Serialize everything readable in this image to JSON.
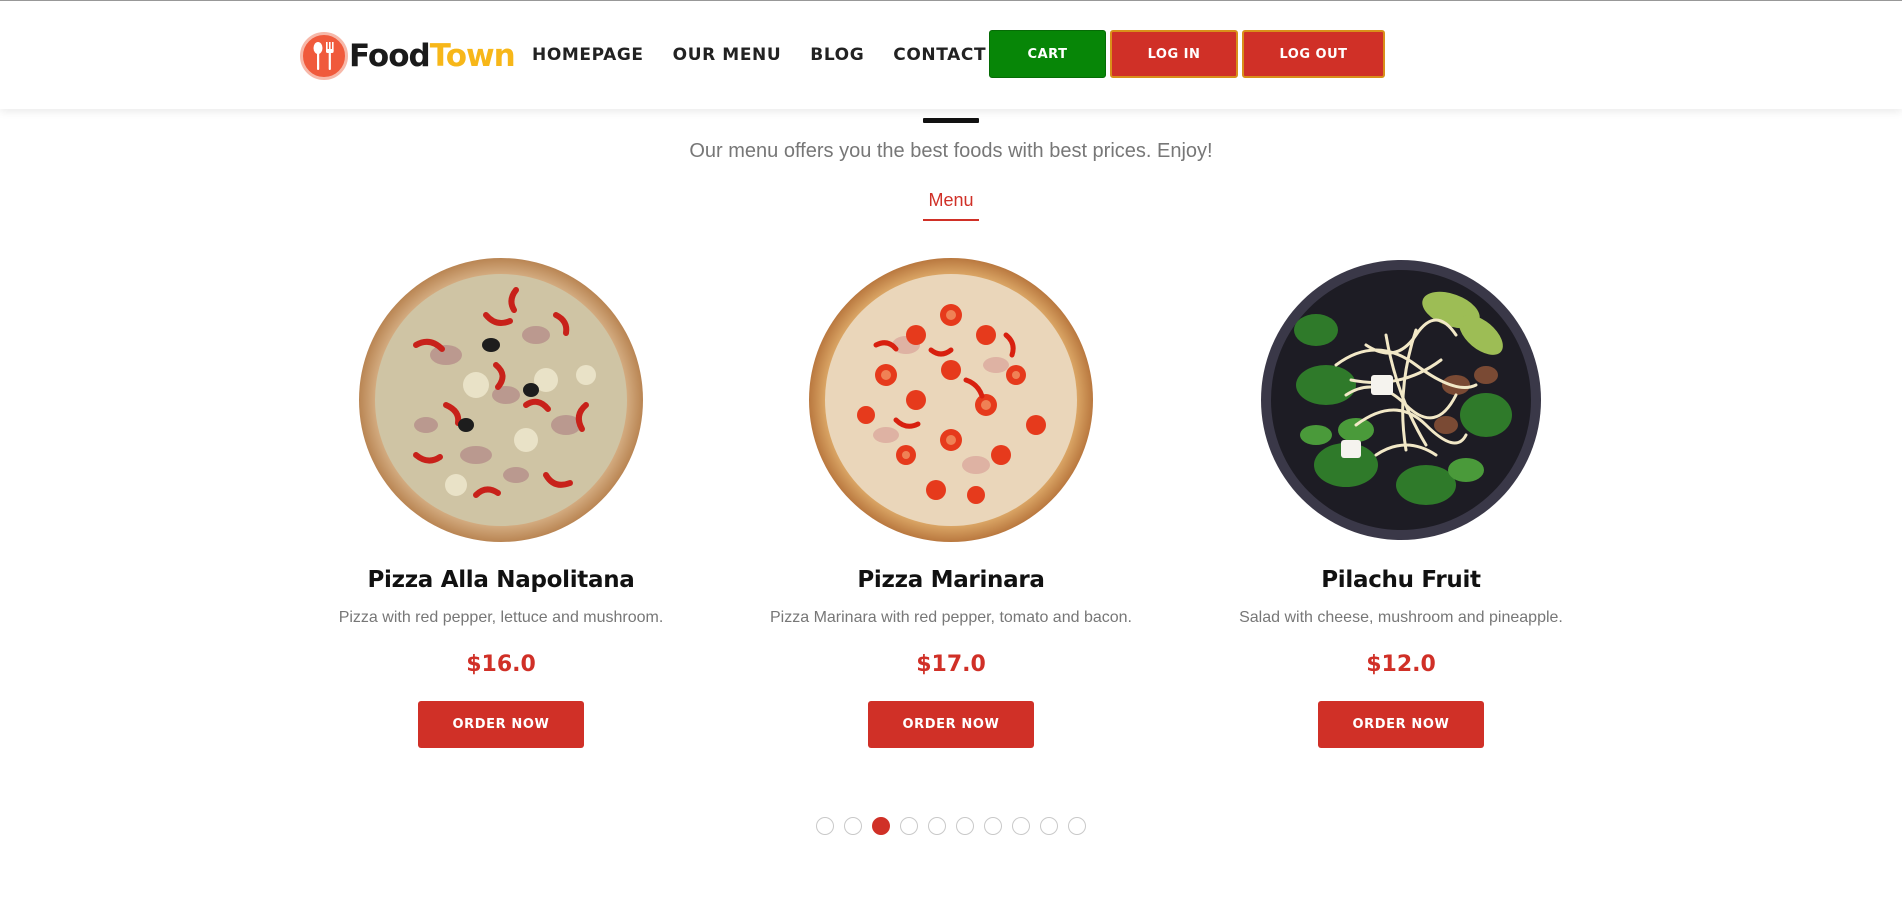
{
  "brand": {
    "food": "Food",
    "town": "Town"
  },
  "nav": [
    {
      "label": "HOMEPAGE"
    },
    {
      "label": "OUR MENU"
    },
    {
      "label": "BLOG"
    },
    {
      "label": "CONTACT US"
    }
  ],
  "header_buttons": {
    "cart": "CART",
    "login": "LOG IN",
    "logout": "LOG OUT"
  },
  "section": {
    "subtitle": "Our menu offers you the best foods with best prices. Enjoy!",
    "tab": "Menu"
  },
  "items": [
    {
      "name": "Pizza Alla Napolitana",
      "desc": "Pizza with red pepper, lettuce and mushroom.",
      "price": "$16.0",
      "cta": "ORDER NOW",
      "image_icon": "pizza-napolitana-image"
    },
    {
      "name": "Pizza Marinara",
      "desc": "Pizza Marinara with red pepper, tomato and bacon.",
      "price": "$17.0",
      "cta": "ORDER NOW",
      "image_icon": "pizza-marinara-image"
    },
    {
      "name": "Pilachu Fruit",
      "desc": "Salad with cheese, mushroom and pineapple.",
      "price": "$12.0",
      "cta": "ORDER NOW",
      "image_icon": "salad-bowl-image"
    }
  ],
  "carousel": {
    "total": 10,
    "active": 3
  },
  "colors": {
    "accent": "#d03027",
    "cart": "#078607",
    "brand_yellow": "#f7b719",
    "brand_red": "#f05a3c"
  }
}
